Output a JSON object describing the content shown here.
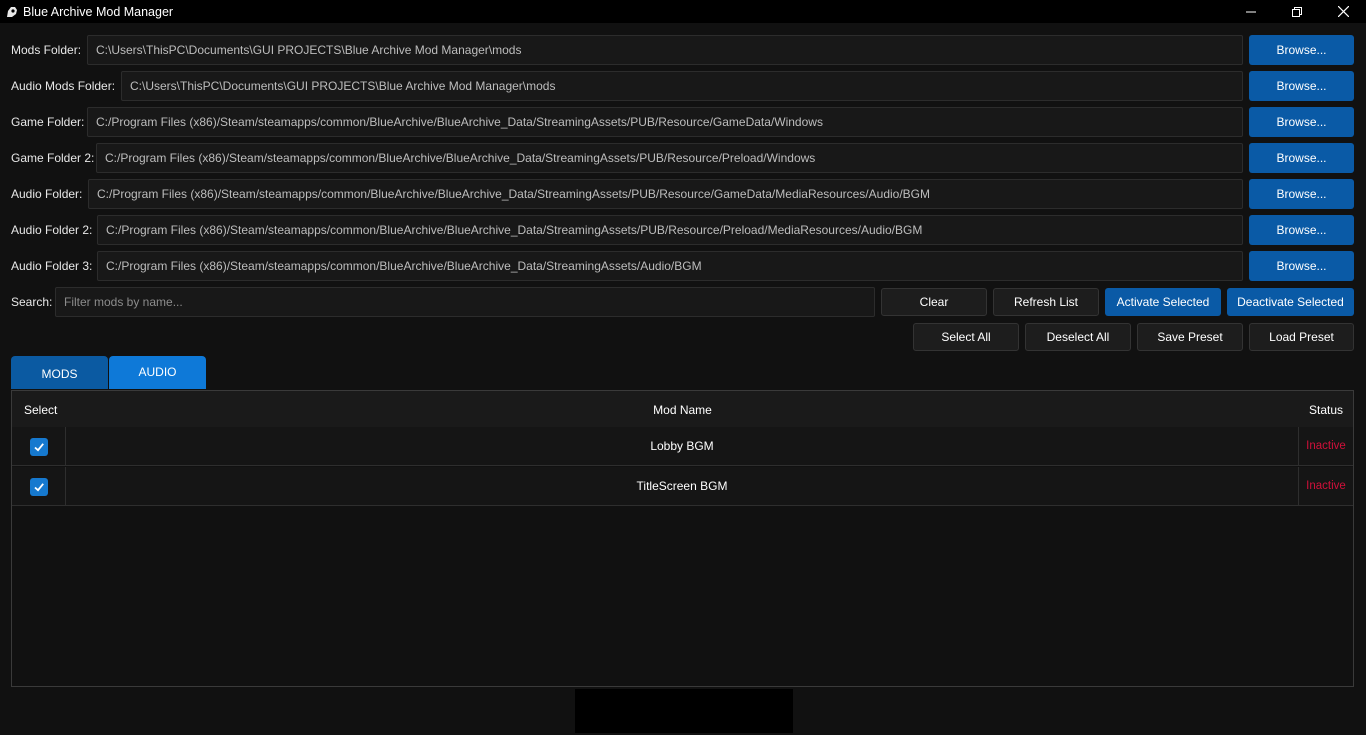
{
  "window": {
    "title": "Blue Archive Mod Manager",
    "app_icon": "ba-app-icon",
    "controls": [
      "minimize-icon",
      "restore-icon",
      "close-icon"
    ]
  },
  "folders": [
    {
      "label": "Mods Folder:",
      "value": "C:\\Users\\ThisPC\\Documents\\GUI PROJECTS\\Blue Archive Mod Manager\\mods",
      "button": "Browse..."
    },
    {
      "label": "Audio Mods Folder:",
      "value": "C:\\Users\\ThisPC\\Documents\\GUI PROJECTS\\Blue Archive Mod Manager\\mods",
      "button": "Browse..."
    },
    {
      "label": "Game Folder:",
      "value": "C:/Program Files (x86)/Steam/steamapps/common/BlueArchive/BlueArchive_Data/StreamingAssets/PUB/Resource/GameData/Windows",
      "button": "Browse..."
    },
    {
      "label": "Game Folder 2:",
      "value": "C:/Program Files (x86)/Steam/steamapps/common/BlueArchive/BlueArchive_Data/StreamingAssets/PUB/Resource/Preload/Windows",
      "button": "Browse..."
    },
    {
      "label": "Audio Folder:",
      "value": "C:/Program Files (x86)/Steam/steamapps/common/BlueArchive/BlueArchive_Data/StreamingAssets/PUB/Resource/GameData/MediaResources/Audio/BGM",
      "button": "Browse..."
    },
    {
      "label": "Audio Folder 2:",
      "value": "C:/Program Files (x86)/Steam/steamapps/common/BlueArchive/BlueArchive_Data/StreamingAssets/PUB/Resource/Preload/MediaResources/Audio/BGM",
      "button": "Browse..."
    },
    {
      "label": "Audio Folder 3:",
      "value": "C:/Program Files (x86)/Steam/steamapps/common/BlueArchive/BlueArchive_Data/StreamingAssets/Audio/BGM",
      "button": "Browse..."
    }
  ],
  "search": {
    "label": "Search:",
    "value": "",
    "placeholder": "Filter mods by name..."
  },
  "actions": {
    "clear": "Clear",
    "refresh": "Refresh List",
    "activate": "Activate Selected",
    "deactivate": "Deactivate Selected",
    "select_all": "Select All",
    "deselect_all": "Deselect All",
    "save_preset": "Save Preset",
    "load_preset": "Load Preset"
  },
  "tabs": [
    {
      "label": "MODS",
      "active": false
    },
    {
      "label": "AUDIO",
      "active": true
    }
  ],
  "table": {
    "columns": [
      "Select",
      "Mod Name",
      "Status"
    ],
    "rows": [
      {
        "checked": true,
        "name": "Lobby BGM",
        "status": "Inactive"
      },
      {
        "checked": true,
        "name": "TitleScreen BGM",
        "status": "Inactive"
      }
    ]
  },
  "colors": {
    "accent": "#0a5aa6",
    "tab_active": "#0e79d8",
    "inactive_status": "#d0103a",
    "background": "#111111"
  }
}
